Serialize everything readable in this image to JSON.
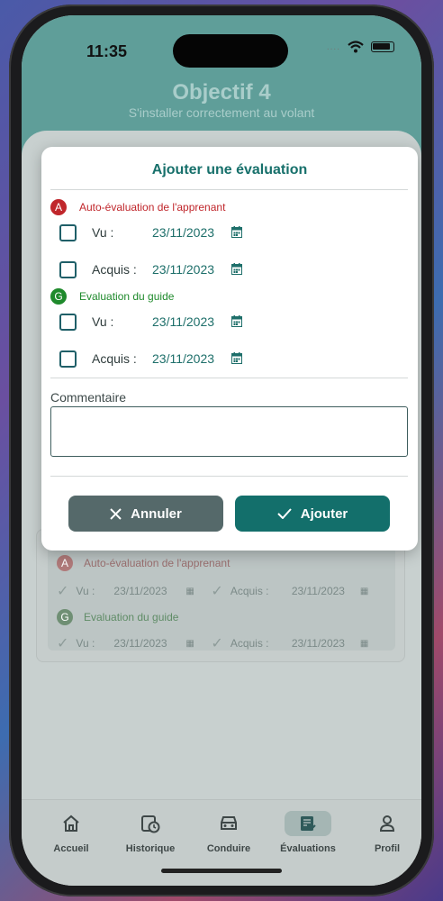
{
  "status_bar": {
    "time": "11:35",
    "dots": "....",
    "wifi_icon": "wifi-icon",
    "battery_icon": "battery-icon"
  },
  "header": {
    "title": "Objectif 4",
    "subtitle": "S'installer correctement au volant"
  },
  "dialog": {
    "title": "Ajouter une évaluation",
    "learner_section": {
      "badge": "A",
      "label": "Auto-évaluation de l'apprenant",
      "rows": [
        {
          "label": "Vu :",
          "date": "23/11/2023"
        },
        {
          "label": "Acquis :",
          "date": "23/11/2023"
        }
      ]
    },
    "guide_section": {
      "badge": "G",
      "label": "Evaluation du guide",
      "rows": [
        {
          "label": "Vu :",
          "date": "23/11/2023"
        },
        {
          "label": "Acquis :",
          "date": "23/11/2023"
        }
      ]
    },
    "comment_label": "Commentaire",
    "comment_value": "",
    "cancel_label": "Annuler",
    "add_label": "Ajouter"
  },
  "background_card": {
    "learner": {
      "badge": "A",
      "label": "Auto-évaluation de l'apprenant",
      "vu": "Vu :",
      "vu_date": "23/11/2023",
      "acquis": "Acquis :",
      "acquis_date": "23/11/2023"
    },
    "guide": {
      "badge": "G",
      "label": "Evaluation du guide",
      "vu": "Vu :",
      "vu_date": "23/11/2023",
      "acquis": "Acquis :",
      "acquis_date": "23/11/2023"
    }
  },
  "tabs": [
    {
      "label": "Accueil",
      "icon": "home-icon"
    },
    {
      "label": "Historique",
      "icon": "history-icon"
    },
    {
      "label": "Conduire",
      "icon": "car-icon"
    },
    {
      "label": "Évaluations",
      "icon": "evaluations-icon",
      "active": true
    },
    {
      "label": "Profil",
      "icon": "profile-icon"
    }
  ],
  "colors": {
    "primary": "#136f6b",
    "cancel": "#55696a",
    "learner_badge": "#c0262b",
    "guide_badge": "#1f8a2c"
  }
}
